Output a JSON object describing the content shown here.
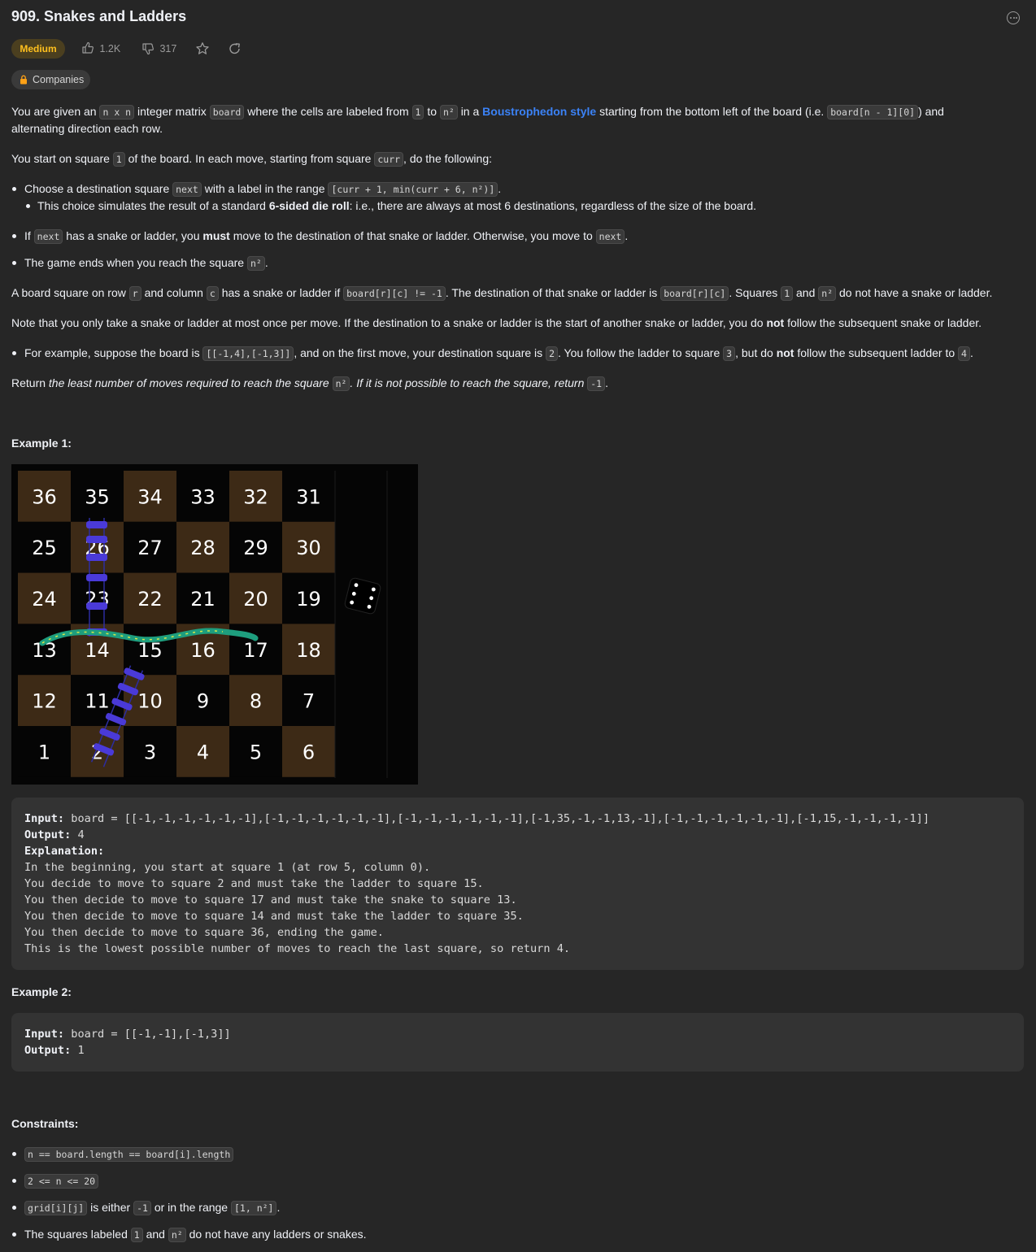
{
  "header": {
    "title": "909. Snakes and Ladders",
    "difficulty": "Medium",
    "likes": "1.2K",
    "dislikes": "317",
    "companies_label": "Companies"
  },
  "desc": {
    "p1_a": "You are given an",
    "p1_code1": "n x n",
    "p1_b": "integer matrix",
    "p1_code2": "board",
    "p1_c": "where the cells are labeled from",
    "p1_code3": "1",
    "p1_d": "to",
    "p1_code4": "n²",
    "p1_e": "in a",
    "p1_link": "Boustrophedon style",
    "p1_f": "starting from the bottom left of the board (i.e.",
    "p1_code5": "board[n - 1][0]",
    "p1_g": ") and",
    "p1_h": "alternating direction each row.",
    "p2_a": "You start on square",
    "p2_code1": "1",
    "p2_b": "of the board. In each move, starting from square",
    "p2_code2": "curr",
    "p2_c": ", do the following:",
    "b1_a": "Choose a destination square",
    "b1_code1": "next",
    "b1_b": "with a label in the range",
    "b1_code2": "[curr + 1, min(curr + 6, n²)]",
    "b1_c": ".",
    "b1s_a": "This choice simulates the result of a standard",
    "b1s_bold": "6-sided die roll",
    "b1s_b": ": i.e., there are always at most 6 destinations, regardless of the size of the board.",
    "b2_a": "If",
    "b2_code1": "next",
    "b2_b": "has a snake or ladder, you",
    "b2_bold": "must",
    "b2_c": "move to the destination of that snake or ladder. Otherwise, you move to",
    "b2_code2": "next",
    "b2_d": ".",
    "b3_a": "The game ends when you reach the square",
    "b3_code": "n²",
    "b3_b": ".",
    "p3_a": "A board square on row",
    "p3_code1": "r",
    "p3_b": "and column",
    "p3_code2": "c",
    "p3_c": "has a snake or ladder if",
    "p3_code3": "board[r][c] != -1",
    "p3_d": ". The destination of that snake or ladder is",
    "p3_code4": "board[r][c]",
    "p3_e": ". Squares",
    "p3_code5": "1",
    "p3_f": "and",
    "p3_code6": "n²",
    "p3_g": "do not have a snake or ladder.",
    "p4_a": "Note that you only take a snake or ladder at most once per move. If the destination to a snake or ladder is the start of another snake or ladder, you do",
    "p4_bold": "not",
    "p4_b": "follow the subsequent snake or ladder.",
    "b4_a": "For example, suppose the board is",
    "b4_code1": "[[-1,4],[-1,3]]",
    "b4_b": ", and on the first move, your destination square is",
    "b4_code2": "2",
    "b4_c": ". You follow the ladder to square",
    "b4_code3": "3",
    "b4_d": ", but do",
    "b4_bold": "not",
    "b4_e": "follow the subsequent ladder to",
    "b4_code4": "4",
    "b4_f": ".",
    "p5_a": "Return",
    "p5_i1": "the least number of moves required to reach the square",
    "p5_code1": "n²",
    "p5_i2": ". If it is not possible to reach the square, return",
    "p5_code2": "-1",
    "p5_b": "."
  },
  "example1": {
    "title": "Example 1:",
    "board_labels": [
      [
        "36",
        "35",
        "34",
        "33",
        "32",
        "31"
      ],
      [
        "25",
        "26",
        "27",
        "28",
        "29",
        "30"
      ],
      [
        "24",
        "23",
        "22",
        "21",
        "20",
        "19"
      ],
      [
        "13",
        "14",
        "15",
        "16",
        "17",
        "18"
      ],
      [
        "12",
        "11",
        "10",
        "9",
        "8",
        "7"
      ],
      [
        "1",
        "2",
        "3",
        "4",
        "5",
        "6"
      ]
    ],
    "input_label": "Input:",
    "input_value": "board = [[-1,-1,-1,-1,-1,-1],[-1,-1,-1,-1,-1,-1],[-1,-1,-1,-1,-1,-1],[-1,35,-1,-1,13,-1],[-1,-1,-1,-1,-1,-1],[-1,15,-1,-1,-1,-1]]",
    "output_label": "Output:",
    "output_value": "4",
    "explanation_label": "Explanation:",
    "explanation_lines": [
      "In the beginning, you start at square 1 (at row 5, column 0).",
      "You decide to move to square 2 and must take the ladder to square 15.",
      "You then decide to move to square 17 and must take the snake to square 13.",
      "You then decide to move to square 14 and must take the ladder to square 35.",
      "You then decide to move to square 36, ending the game.",
      "This is the lowest possible number of moves to reach the last square, so return 4."
    ]
  },
  "example2": {
    "title": "Example 2:",
    "input_label": "Input:",
    "input_value": "board = [[-1,-1],[-1,3]]",
    "output_label": "Output:",
    "output_value": "1"
  },
  "constraints": {
    "title": "Constraints:",
    "c1_code": "n == board.length == board[i].length",
    "c2_code": "2 <= n <= 20",
    "c3_code1": "grid[i][j]",
    "c3_a": "is either",
    "c3_code2": "-1",
    "c3_b": "or in the range",
    "c3_code3": "[1, n²]",
    "c3_c": ".",
    "c4_a": "The squares labeled",
    "c4_code1": "1",
    "c4_b": "and",
    "c4_code2": "n²",
    "c4_c": "do not have any ladders or snakes."
  },
  "colors": {
    "background": "#262626",
    "link": "#3b82f6",
    "difficulty": "#ffc01e",
    "board_brown": "#3d2a16",
    "board_black": "#050505"
  }
}
